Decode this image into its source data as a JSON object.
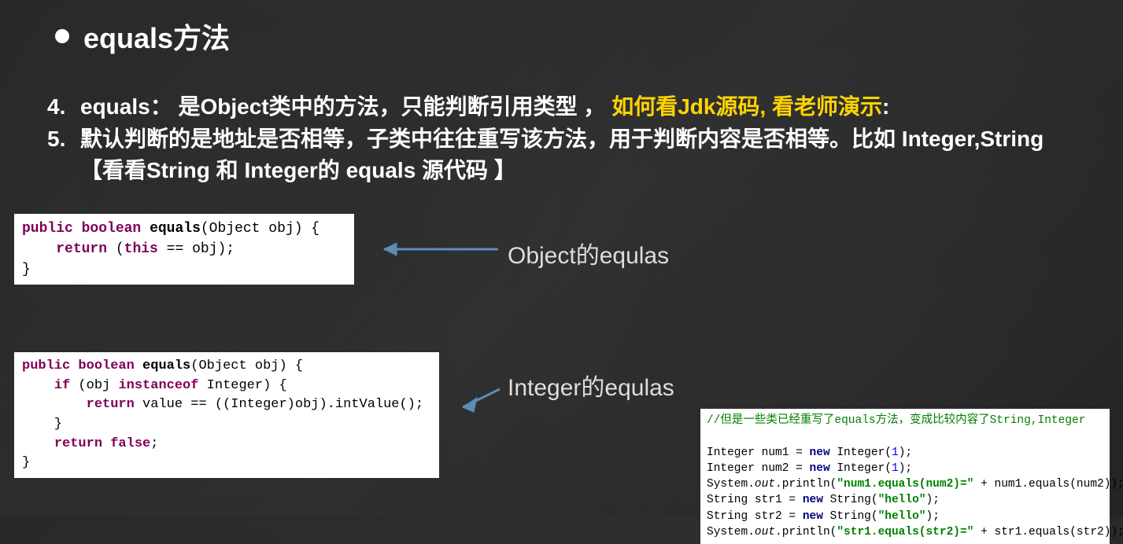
{
  "header": {
    "title": "equals方法"
  },
  "points": {
    "p4": {
      "num": "4.",
      "text_before": "equals：  是Object类中的方法，只能判断引用类型 ， ",
      "text_highlight": "如何看Jdk源码, 看老师演示",
      "text_after": ":"
    },
    "p5": {
      "num": "5.",
      "text": "默认判断的是地址是否相等，子类中往往重写该方法，用于判断内容是否相等。比如 Integer,String 【看看String 和 Integer的 equals 源代码 】"
    }
  },
  "labels": {
    "object_equals": "Object的equlas",
    "integer_equals": "Integer的equlas"
  },
  "code1": {
    "kw_public": "public",
    "kw_boolean": "boolean",
    "fn": "equals",
    "sig_rest": "(Object obj) {",
    "kw_return": "return",
    "kw_this": "this",
    "ret_rest": " == obj);",
    "close": "}"
  },
  "code2": {
    "kw_public": "public",
    "kw_boolean": "boolean",
    "fn": "equals",
    "sig_rest": "(Object obj) {",
    "kw_if": "if",
    "if_open": " (obj ",
    "kw_instanceof": "instanceof",
    "if_rest": " Integer) {",
    "kw_return1": "return",
    "ret1_rest": " value == ((Integer)obj).intValue();",
    "brace_close1": "    }",
    "kw_return2": "return",
    "kw_false": "false",
    "semi": ";",
    "close": "}"
  },
  "code3": {
    "comment": "//但是一些类已经重写了equals方法，变成比较内容了String,Integer",
    "l1_a": "Integer ",
    "l1_b": "num1",
    "l1_c": " = ",
    "l1_new": "new",
    "l1_d": " Integer(",
    "l1_n": "1",
    "l1_e": ");",
    "l2_a": "Integer ",
    "l2_b": "num2",
    "l2_c": " = ",
    "l2_new": "new",
    "l2_d": " Integer(",
    "l2_n": "1",
    "l2_e": ");",
    "l3_a": "System.",
    "l3_out": "out",
    "l3_b": ".println(",
    "l3_str": "\"num1.equals(num2)=\"",
    "l3_c": " + num1.equals(num2));",
    "l4_a": "String ",
    "l4_b": "str1",
    "l4_c": " = ",
    "l4_new": "new",
    "l4_d": " String(",
    "l4_str": "\"hello\"",
    "l4_e": ");",
    "l5_a": "String ",
    "l5_b": "str2",
    "l5_c": " = ",
    "l5_new": "new",
    "l5_d": " String(",
    "l5_str": "\"hello\"",
    "l5_e": ");",
    "l6_a": "System.",
    "l6_out": "out",
    "l6_b": ".println(",
    "l6_str": "\"str1.equals(str2)=\"",
    "l6_c": " + str1.equals(str2));"
  }
}
